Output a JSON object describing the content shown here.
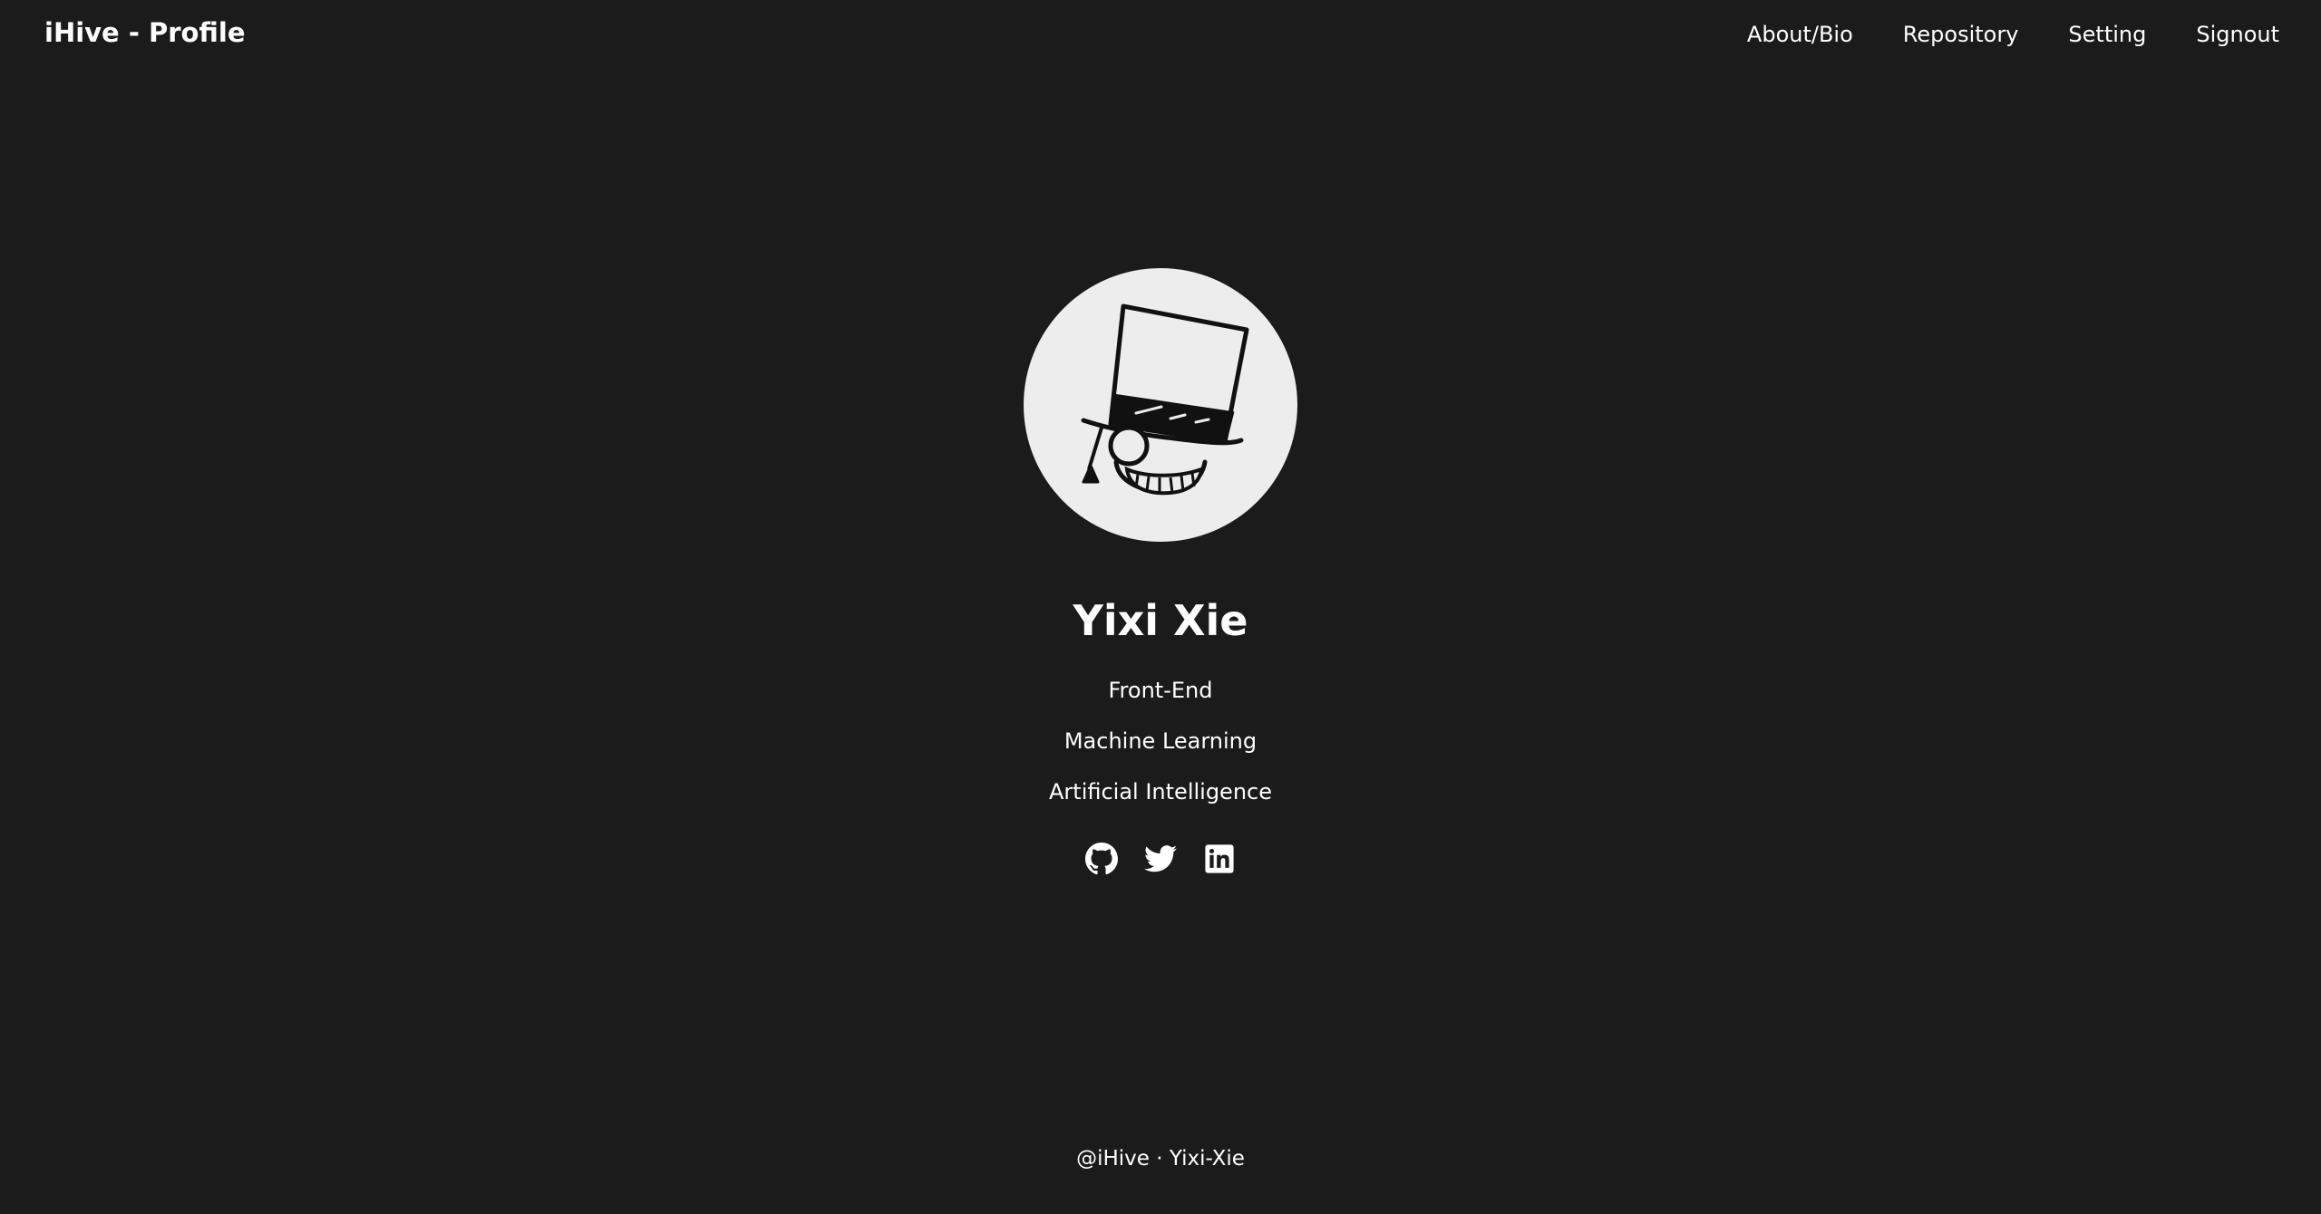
{
  "header": {
    "title": "iHive - Profile",
    "nav": [
      "About/Bio",
      "Repository",
      "Setting",
      "Signout"
    ]
  },
  "profile": {
    "name": "Yixi Xie",
    "tags": [
      "Front-End",
      "Machine Learning",
      "Artificial Intelligence"
    ],
    "avatar_icon": "top-hat-monocle-character-icon",
    "socials": [
      {
        "icon": "github-icon"
      },
      {
        "icon": "twitter-icon"
      },
      {
        "icon": "linkedin-icon"
      }
    ]
  },
  "footer": {
    "text": "@iHive · Yixi-Xie"
  },
  "colors": {
    "background": "#1b1b1b",
    "text": "#ffffff",
    "avatar_bg": "#ededed"
  }
}
